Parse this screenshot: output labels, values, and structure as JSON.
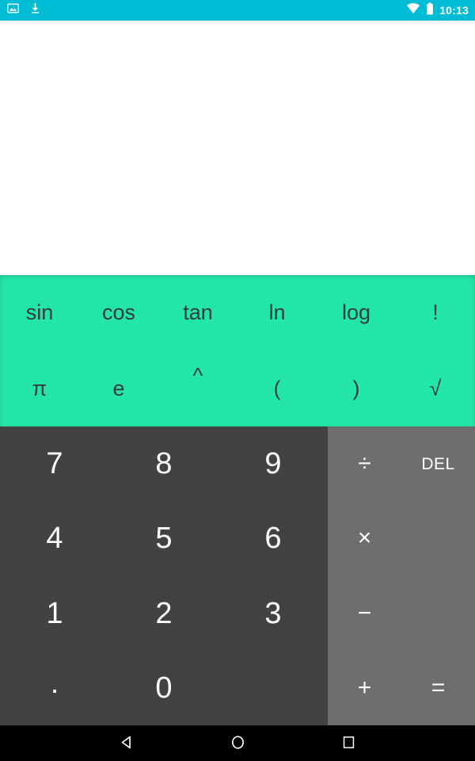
{
  "status_bar": {
    "background_color": "#00bcd4",
    "time": "10:13",
    "left_icons": [
      "image-icon",
      "download-icon"
    ],
    "right_icons": [
      "wifi-icon",
      "battery-icon"
    ]
  },
  "display": {
    "formula": "",
    "result": "",
    "background_color": "#ffffff"
  },
  "scientific_pad": {
    "background_color": "#23e5a8",
    "text_color": "#2c3e3a",
    "rows": [
      [
        {
          "label": "sin",
          "name": "sin-key"
        },
        {
          "label": "cos",
          "name": "cos-key"
        },
        {
          "label": "tan",
          "name": "tan-key"
        },
        {
          "label": "ln",
          "name": "ln-key"
        },
        {
          "label": "log",
          "name": "log-key"
        },
        {
          "label": "!",
          "name": "factorial-key"
        }
      ],
      [
        {
          "label": "π",
          "name": "pi-key"
        },
        {
          "label": "e",
          "name": "euler-key"
        },
        {
          "label": "^",
          "name": "power-key"
        },
        {
          "label": "(",
          "name": "open-paren-key"
        },
        {
          "label": ")",
          "name": "close-paren-key"
        },
        {
          "label": "√",
          "name": "sqrt-key"
        }
      ]
    ]
  },
  "numeric_pad": {
    "background_color": "#424242",
    "text_color": "#ffffff",
    "rows": [
      [
        {
          "label": "7",
          "name": "digit-7-key"
        },
        {
          "label": "8",
          "name": "digit-8-key"
        },
        {
          "label": "9",
          "name": "digit-9-key"
        }
      ],
      [
        {
          "label": "4",
          "name": "digit-4-key"
        },
        {
          "label": "5",
          "name": "digit-5-key"
        },
        {
          "label": "6",
          "name": "digit-6-key"
        }
      ],
      [
        {
          "label": "1",
          "name": "digit-1-key"
        },
        {
          "label": "2",
          "name": "digit-2-key"
        },
        {
          "label": "3",
          "name": "digit-3-key"
        }
      ],
      [
        {
          "label": ".",
          "name": "decimal-point-key"
        },
        {
          "label": "0",
          "name": "digit-0-key"
        },
        {
          "label": "",
          "name": "empty-key"
        }
      ]
    ]
  },
  "operator_pad": {
    "background_color": "#6e6e6e",
    "text_color": "#ffffff",
    "rows": [
      [
        {
          "label": "÷",
          "name": "divide-key"
        },
        {
          "label": "DEL",
          "name": "delete-key"
        }
      ],
      [
        {
          "label": "×",
          "name": "multiply-key"
        },
        {
          "label": "",
          "name": "empty-key"
        }
      ],
      [
        {
          "label": "−",
          "name": "subtract-key"
        },
        {
          "label": "",
          "name": "empty-key"
        }
      ],
      [
        {
          "label": "+",
          "name": "add-key"
        },
        {
          "label": "=",
          "name": "equals-key"
        }
      ]
    ]
  },
  "nav_bar": {
    "background_color": "#000000",
    "buttons": [
      {
        "name": "back-button",
        "icon": "triangle-left-icon"
      },
      {
        "name": "home-button",
        "icon": "circle-icon"
      },
      {
        "name": "recents-button",
        "icon": "square-icon"
      }
    ]
  }
}
